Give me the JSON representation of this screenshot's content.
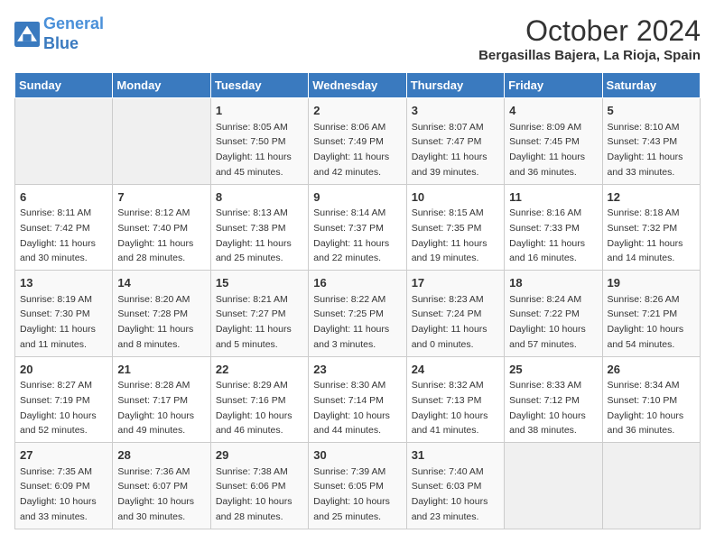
{
  "logo": {
    "line1": "General",
    "line2": "Blue"
  },
  "title": "October 2024",
  "location": "Bergasillas Bajera, La Rioja, Spain",
  "days_of_week": [
    "Sunday",
    "Monday",
    "Tuesday",
    "Wednesday",
    "Thursday",
    "Friday",
    "Saturday"
  ],
  "weeks": [
    [
      {
        "day": "",
        "info": ""
      },
      {
        "day": "",
        "info": ""
      },
      {
        "day": "1",
        "info": "Sunrise: 8:05 AM\nSunset: 7:50 PM\nDaylight: 11 hours and 45 minutes."
      },
      {
        "day": "2",
        "info": "Sunrise: 8:06 AM\nSunset: 7:49 PM\nDaylight: 11 hours and 42 minutes."
      },
      {
        "day": "3",
        "info": "Sunrise: 8:07 AM\nSunset: 7:47 PM\nDaylight: 11 hours and 39 minutes."
      },
      {
        "day": "4",
        "info": "Sunrise: 8:09 AM\nSunset: 7:45 PM\nDaylight: 11 hours and 36 minutes."
      },
      {
        "day": "5",
        "info": "Sunrise: 8:10 AM\nSunset: 7:43 PM\nDaylight: 11 hours and 33 minutes."
      }
    ],
    [
      {
        "day": "6",
        "info": "Sunrise: 8:11 AM\nSunset: 7:42 PM\nDaylight: 11 hours and 30 minutes."
      },
      {
        "day": "7",
        "info": "Sunrise: 8:12 AM\nSunset: 7:40 PM\nDaylight: 11 hours and 28 minutes."
      },
      {
        "day": "8",
        "info": "Sunrise: 8:13 AM\nSunset: 7:38 PM\nDaylight: 11 hours and 25 minutes."
      },
      {
        "day": "9",
        "info": "Sunrise: 8:14 AM\nSunset: 7:37 PM\nDaylight: 11 hours and 22 minutes."
      },
      {
        "day": "10",
        "info": "Sunrise: 8:15 AM\nSunset: 7:35 PM\nDaylight: 11 hours and 19 minutes."
      },
      {
        "day": "11",
        "info": "Sunrise: 8:16 AM\nSunset: 7:33 PM\nDaylight: 11 hours and 16 minutes."
      },
      {
        "day": "12",
        "info": "Sunrise: 8:18 AM\nSunset: 7:32 PM\nDaylight: 11 hours and 14 minutes."
      }
    ],
    [
      {
        "day": "13",
        "info": "Sunrise: 8:19 AM\nSunset: 7:30 PM\nDaylight: 11 hours and 11 minutes."
      },
      {
        "day": "14",
        "info": "Sunrise: 8:20 AM\nSunset: 7:28 PM\nDaylight: 11 hours and 8 minutes."
      },
      {
        "day": "15",
        "info": "Sunrise: 8:21 AM\nSunset: 7:27 PM\nDaylight: 11 hours and 5 minutes."
      },
      {
        "day": "16",
        "info": "Sunrise: 8:22 AM\nSunset: 7:25 PM\nDaylight: 11 hours and 3 minutes."
      },
      {
        "day": "17",
        "info": "Sunrise: 8:23 AM\nSunset: 7:24 PM\nDaylight: 11 hours and 0 minutes."
      },
      {
        "day": "18",
        "info": "Sunrise: 8:24 AM\nSunset: 7:22 PM\nDaylight: 10 hours and 57 minutes."
      },
      {
        "day": "19",
        "info": "Sunrise: 8:26 AM\nSunset: 7:21 PM\nDaylight: 10 hours and 54 minutes."
      }
    ],
    [
      {
        "day": "20",
        "info": "Sunrise: 8:27 AM\nSunset: 7:19 PM\nDaylight: 10 hours and 52 minutes."
      },
      {
        "day": "21",
        "info": "Sunrise: 8:28 AM\nSunset: 7:17 PM\nDaylight: 10 hours and 49 minutes."
      },
      {
        "day": "22",
        "info": "Sunrise: 8:29 AM\nSunset: 7:16 PM\nDaylight: 10 hours and 46 minutes."
      },
      {
        "day": "23",
        "info": "Sunrise: 8:30 AM\nSunset: 7:14 PM\nDaylight: 10 hours and 44 minutes."
      },
      {
        "day": "24",
        "info": "Sunrise: 8:32 AM\nSunset: 7:13 PM\nDaylight: 10 hours and 41 minutes."
      },
      {
        "day": "25",
        "info": "Sunrise: 8:33 AM\nSunset: 7:12 PM\nDaylight: 10 hours and 38 minutes."
      },
      {
        "day": "26",
        "info": "Sunrise: 8:34 AM\nSunset: 7:10 PM\nDaylight: 10 hours and 36 minutes."
      }
    ],
    [
      {
        "day": "27",
        "info": "Sunrise: 7:35 AM\nSunset: 6:09 PM\nDaylight: 10 hours and 33 minutes."
      },
      {
        "day": "28",
        "info": "Sunrise: 7:36 AM\nSunset: 6:07 PM\nDaylight: 10 hours and 30 minutes."
      },
      {
        "day": "29",
        "info": "Sunrise: 7:38 AM\nSunset: 6:06 PM\nDaylight: 10 hours and 28 minutes."
      },
      {
        "day": "30",
        "info": "Sunrise: 7:39 AM\nSunset: 6:05 PM\nDaylight: 10 hours and 25 minutes."
      },
      {
        "day": "31",
        "info": "Sunrise: 7:40 AM\nSunset: 6:03 PM\nDaylight: 10 hours and 23 minutes."
      },
      {
        "day": "",
        "info": ""
      },
      {
        "day": "",
        "info": ""
      }
    ]
  ]
}
